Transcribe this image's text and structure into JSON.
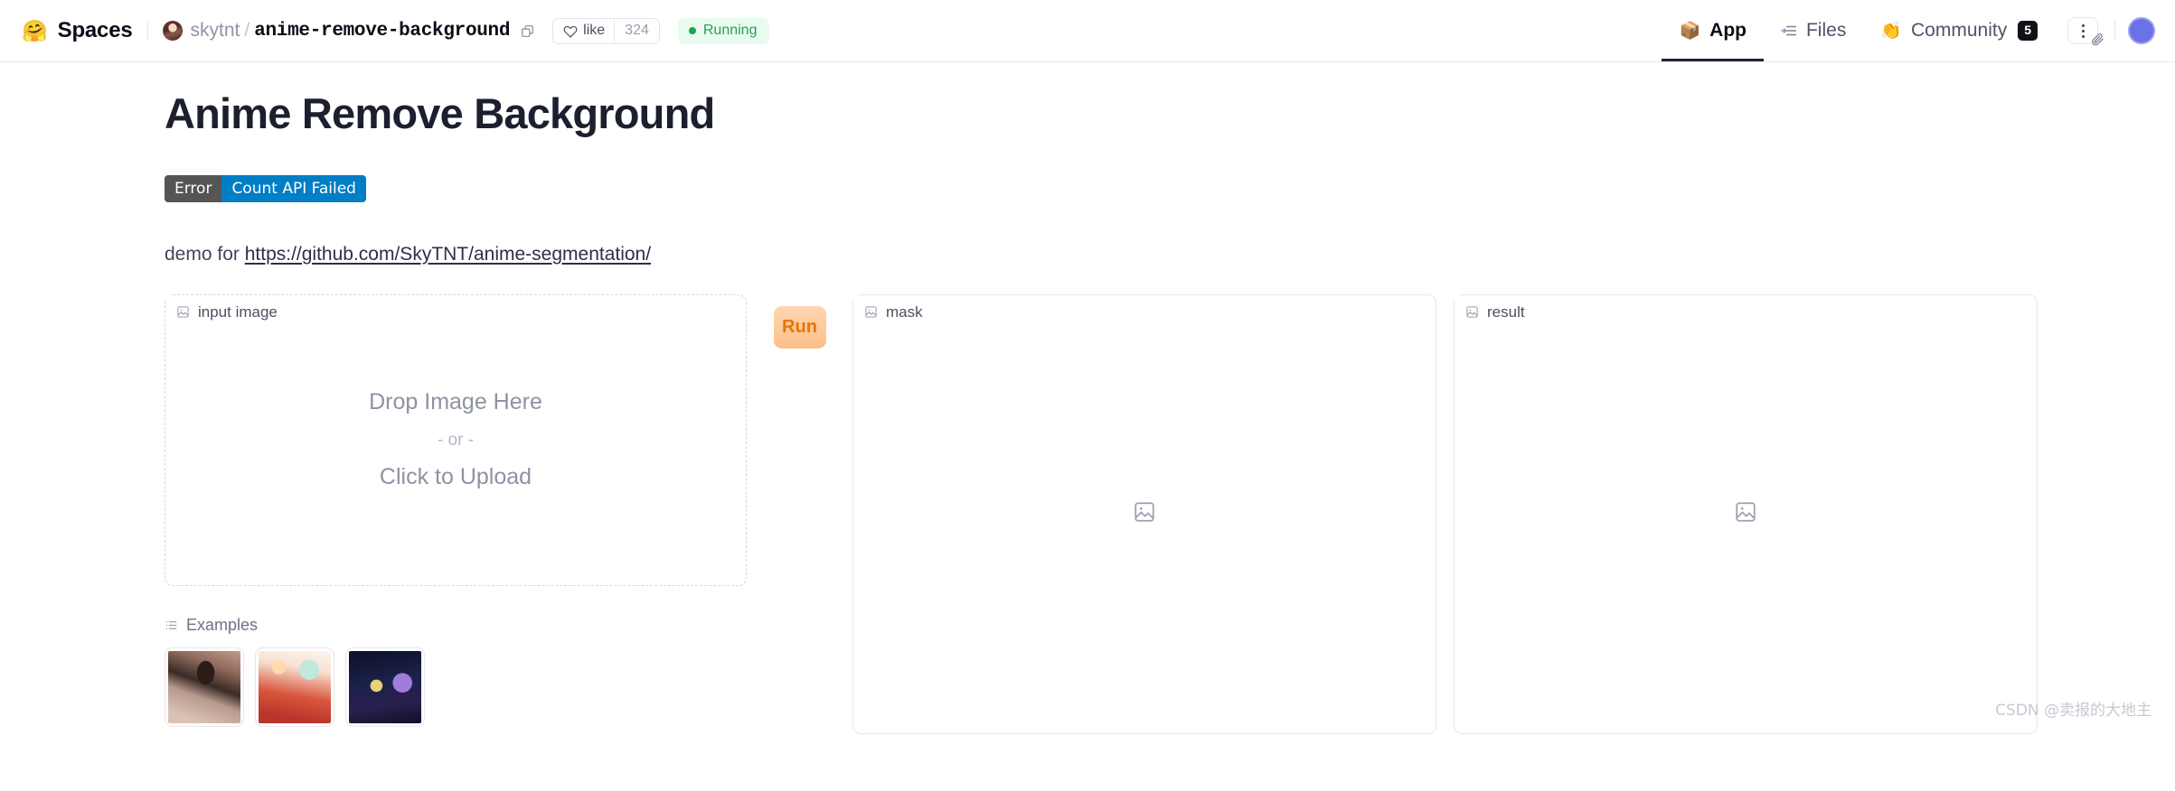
{
  "header": {
    "spaces_emoji": "🤗",
    "spaces_label": "Spaces",
    "owner": "skytnt",
    "separator": "/",
    "repo": "anime-remove-background",
    "copy_icon": "copy-icon",
    "like_label": "like",
    "like_count": "324",
    "status_label": "Running",
    "status_color": "#1ea34f",
    "tabs": [
      {
        "label": "App",
        "icon": "cube-icon",
        "active": true
      },
      {
        "label": "Files",
        "icon": "files-icon",
        "active": false
      },
      {
        "label": "Community",
        "icon": "wave-hand-icon",
        "active": false,
        "badge": "5"
      }
    ],
    "kebab_icon": "more-options-icon",
    "link_icon": "paperclip-icon",
    "avatar": "user-avatar"
  },
  "main": {
    "title": "Anime Remove Background",
    "badge": {
      "left": "Error",
      "right": "Count API Failed",
      "left_color": "#555555",
      "right_color": "#007ec6"
    },
    "demo_prefix": "demo for ",
    "demo_link": "https://github.com/SkyTNT/anime-segmentation/"
  },
  "input_panel": {
    "label": "input image",
    "icon": "image-icon",
    "drop_text": "Drop Image Here",
    "or_text": "- or -",
    "upload_text": "Click to Upload"
  },
  "run": {
    "label": "Run",
    "color": "#e9730a"
  },
  "mask_panel": {
    "label": "mask",
    "icon": "image-icon",
    "placeholder_icon": "image-placeholder-icon"
  },
  "result_panel": {
    "label": "result",
    "icon": "image-icon",
    "placeholder_icon": "image-placeholder-icon"
  },
  "examples": {
    "label": "Examples",
    "icon": "list-icon",
    "items": [
      {
        "name": "example-1"
      },
      {
        "name": "example-2"
      },
      {
        "name": "example-3"
      }
    ]
  },
  "watermark": "CSDN @卖报的大地主"
}
